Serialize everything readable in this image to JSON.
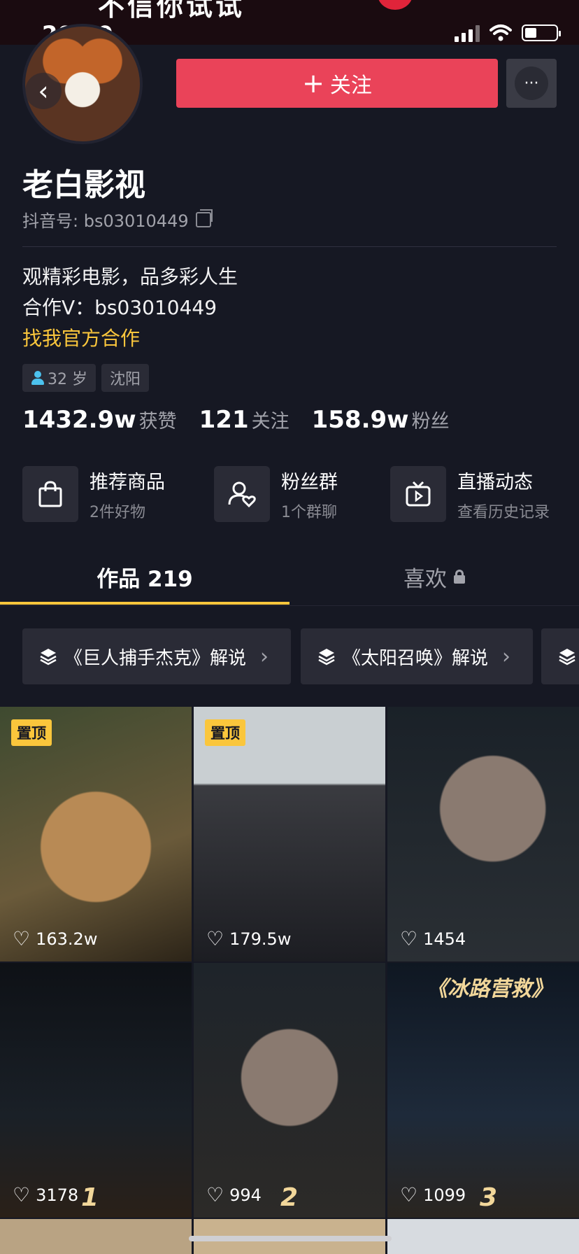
{
  "banner": {
    "text": "不信你试试"
  },
  "status_bar": {
    "time": "20:19"
  },
  "header": {
    "follow_label": "关注",
    "back_icon": "chevron-left-icon",
    "more_icon": "more-icon"
  },
  "profile": {
    "name": "老白影视",
    "douyin_id": "抖音号: bs03010449",
    "bio_line1": "观精彩电影，品多彩人生",
    "bio_line2": "合作V：bs03010449",
    "bio_link": "找我官方合作",
    "tags": [
      "32 岁",
      "沈阳"
    ]
  },
  "stats": [
    {
      "num": "1432.9w",
      "label": "获赞"
    },
    {
      "num": "121",
      "label": "关注"
    },
    {
      "num": "158.9w",
      "label": "粉丝"
    }
  ],
  "services": [
    {
      "title": "推荐商品",
      "subtitle": "2件好物",
      "icon": "shopping-bag-icon"
    },
    {
      "title": "粉丝群",
      "subtitle": "1个群聊",
      "icon": "fan-group-icon"
    },
    {
      "title": "直播动态",
      "subtitle": "查看历史记录",
      "icon": "live-tv-icon"
    }
  ],
  "tabs": {
    "works": "作品 219",
    "likes": "喜欢"
  },
  "collections": [
    "《巨人捕手杰克》解说",
    "《太阳召唤》解说"
  ],
  "videos": [
    {
      "likes": "163.2w",
      "pinned": "置顶"
    },
    {
      "likes": "179.5w",
      "pinned": "置顶"
    },
    {
      "likes": "1454"
    },
    {
      "likes": "3178",
      "corner": "1"
    },
    {
      "likes": "994",
      "corner": "2"
    },
    {
      "likes": "1099",
      "corner": "3",
      "title_overlay": "《冰路营救》"
    }
  ],
  "colors": {
    "accent": "#ea4359",
    "highlight": "#fac63c",
    "background": "#161823"
  }
}
